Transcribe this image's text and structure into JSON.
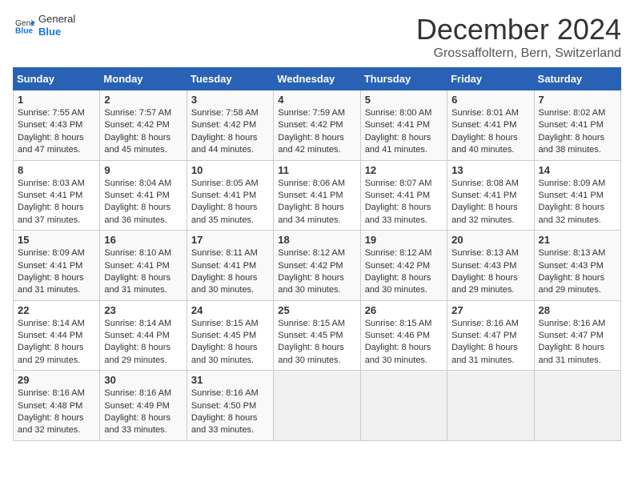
{
  "logo": {
    "general": "General",
    "blue": "Blue"
  },
  "title": "December 2024",
  "location": "Grossaffoltern, Bern, Switzerland",
  "days_of_week": [
    "Sunday",
    "Monday",
    "Tuesday",
    "Wednesday",
    "Thursday",
    "Friday",
    "Saturday"
  ],
  "weeks": [
    [
      {
        "day": "1",
        "sunrise": "7:55 AM",
        "sunset": "4:43 PM",
        "daylight": "8 hours and 47 minutes."
      },
      {
        "day": "2",
        "sunrise": "7:57 AM",
        "sunset": "4:42 PM",
        "daylight": "8 hours and 45 minutes."
      },
      {
        "day": "3",
        "sunrise": "7:58 AM",
        "sunset": "4:42 PM",
        "daylight": "8 hours and 44 minutes."
      },
      {
        "day": "4",
        "sunrise": "7:59 AM",
        "sunset": "4:42 PM",
        "daylight": "8 hours and 42 minutes."
      },
      {
        "day": "5",
        "sunrise": "8:00 AM",
        "sunset": "4:41 PM",
        "daylight": "8 hours and 41 minutes."
      },
      {
        "day": "6",
        "sunrise": "8:01 AM",
        "sunset": "4:41 PM",
        "daylight": "8 hours and 40 minutes."
      },
      {
        "day": "7",
        "sunrise": "8:02 AM",
        "sunset": "4:41 PM",
        "daylight": "8 hours and 38 minutes."
      }
    ],
    [
      {
        "day": "8",
        "sunrise": "8:03 AM",
        "sunset": "4:41 PM",
        "daylight": "8 hours and 37 minutes."
      },
      {
        "day": "9",
        "sunrise": "8:04 AM",
        "sunset": "4:41 PM",
        "daylight": "8 hours and 36 minutes."
      },
      {
        "day": "10",
        "sunrise": "8:05 AM",
        "sunset": "4:41 PM",
        "daylight": "8 hours and 35 minutes."
      },
      {
        "day": "11",
        "sunrise": "8:06 AM",
        "sunset": "4:41 PM",
        "daylight": "8 hours and 34 minutes."
      },
      {
        "day": "12",
        "sunrise": "8:07 AM",
        "sunset": "4:41 PM",
        "daylight": "8 hours and 33 minutes."
      },
      {
        "day": "13",
        "sunrise": "8:08 AM",
        "sunset": "4:41 PM",
        "daylight": "8 hours and 32 minutes."
      },
      {
        "day": "14",
        "sunrise": "8:09 AM",
        "sunset": "4:41 PM",
        "daylight": "8 hours and 32 minutes."
      }
    ],
    [
      {
        "day": "15",
        "sunrise": "8:09 AM",
        "sunset": "4:41 PM",
        "daylight": "8 hours and 31 minutes."
      },
      {
        "day": "16",
        "sunrise": "8:10 AM",
        "sunset": "4:41 PM",
        "daylight": "8 hours and 31 minutes."
      },
      {
        "day": "17",
        "sunrise": "8:11 AM",
        "sunset": "4:41 PM",
        "daylight": "8 hours and 30 minutes."
      },
      {
        "day": "18",
        "sunrise": "8:12 AM",
        "sunset": "4:42 PM",
        "daylight": "8 hours and 30 minutes."
      },
      {
        "day": "19",
        "sunrise": "8:12 AM",
        "sunset": "4:42 PM",
        "daylight": "8 hours and 30 minutes."
      },
      {
        "day": "20",
        "sunrise": "8:13 AM",
        "sunset": "4:43 PM",
        "daylight": "8 hours and 29 minutes."
      },
      {
        "day": "21",
        "sunrise": "8:13 AM",
        "sunset": "4:43 PM",
        "daylight": "8 hours and 29 minutes."
      }
    ],
    [
      {
        "day": "22",
        "sunrise": "8:14 AM",
        "sunset": "4:44 PM",
        "daylight": "8 hours and 29 minutes."
      },
      {
        "day": "23",
        "sunrise": "8:14 AM",
        "sunset": "4:44 PM",
        "daylight": "8 hours and 29 minutes."
      },
      {
        "day": "24",
        "sunrise": "8:15 AM",
        "sunset": "4:45 PM",
        "daylight": "8 hours and 30 minutes."
      },
      {
        "day": "25",
        "sunrise": "8:15 AM",
        "sunset": "4:45 PM",
        "daylight": "8 hours and 30 minutes."
      },
      {
        "day": "26",
        "sunrise": "8:15 AM",
        "sunset": "4:46 PM",
        "daylight": "8 hours and 30 minutes."
      },
      {
        "day": "27",
        "sunrise": "8:16 AM",
        "sunset": "4:47 PM",
        "daylight": "8 hours and 31 minutes."
      },
      {
        "day": "28",
        "sunrise": "8:16 AM",
        "sunset": "4:47 PM",
        "daylight": "8 hours and 31 minutes."
      }
    ],
    [
      {
        "day": "29",
        "sunrise": "8:16 AM",
        "sunset": "4:48 PM",
        "daylight": "8 hours and 32 minutes."
      },
      {
        "day": "30",
        "sunrise": "8:16 AM",
        "sunset": "4:49 PM",
        "daylight": "8 hours and 33 minutes."
      },
      {
        "day": "31",
        "sunrise": "8:16 AM",
        "sunset": "4:50 PM",
        "daylight": "8 hours and 33 minutes."
      },
      null,
      null,
      null,
      null
    ]
  ]
}
